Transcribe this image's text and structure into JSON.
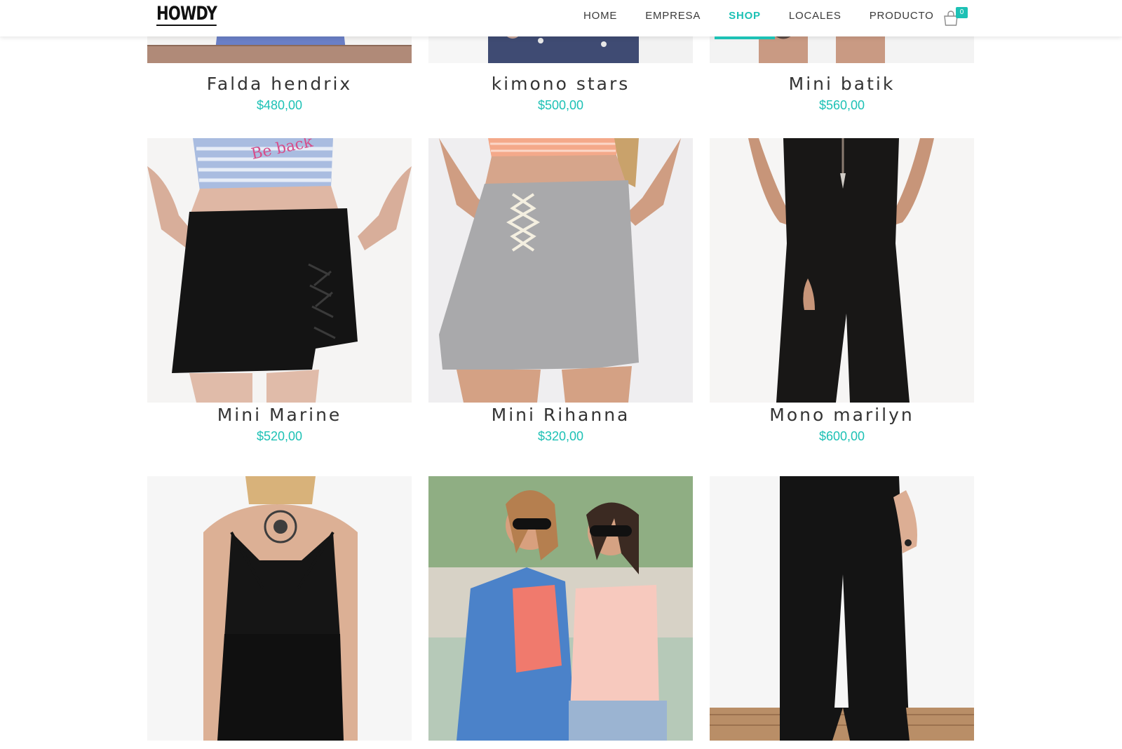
{
  "header": {
    "logo_text": "HOWDY",
    "nav": [
      "HOME",
      "EMPRESA",
      "SHOP",
      "LOCALES",
      "PRODUCTO"
    ],
    "active_nav": "SHOP",
    "cart_count": "0"
  },
  "colors": {
    "accent": "#1dc1b5",
    "text": "#333333"
  },
  "products": [
    {
      "name": "Falda hendrix",
      "price": "$480,00"
    },
    {
      "name": "kimono stars",
      "price": "$500,00"
    },
    {
      "name": "Mini batik",
      "price": "$560,00"
    },
    {
      "name": "Mini Marine",
      "price": "$520,00"
    },
    {
      "name": "Mini Rihanna",
      "price": "$320,00"
    },
    {
      "name": "Mono marilyn",
      "price": "$600,00"
    }
  ]
}
